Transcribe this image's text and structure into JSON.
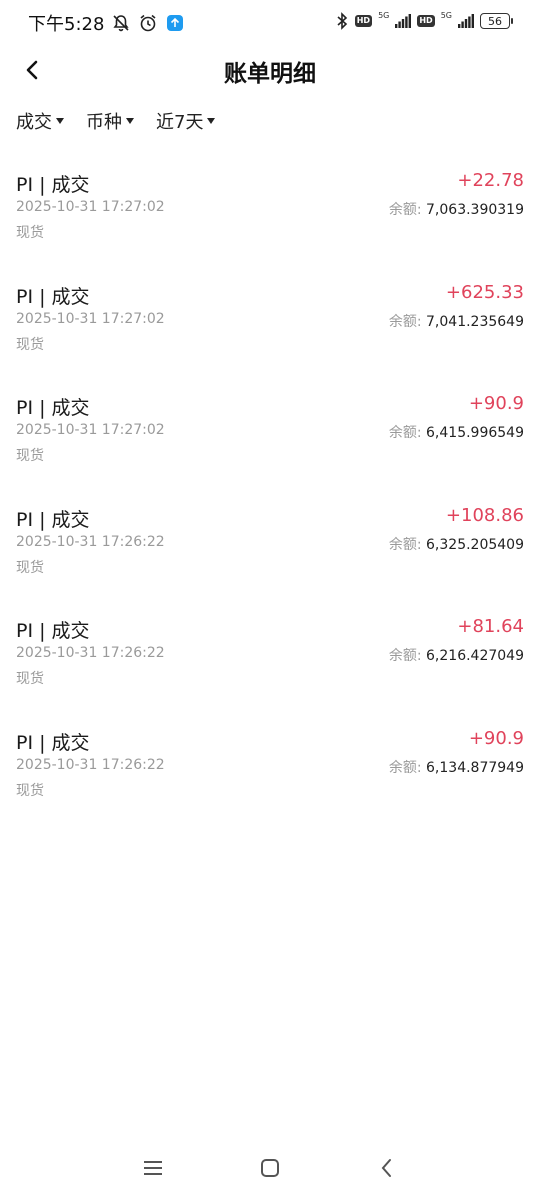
{
  "status": {
    "time": "下午5:28",
    "net1": "5G",
    "net2": "5G",
    "hd1": "HD",
    "hd2": "HD",
    "battery": "56",
    "icons": [
      "bell-off-icon",
      "alarm-icon",
      "upload-app-icon",
      "bluetooth-icon",
      "signal-icon",
      "battery-icon"
    ]
  },
  "header": {
    "title": "账单明细",
    "back_icon": "chevron-left-icon"
  },
  "filters": [
    {
      "label": "成交"
    },
    {
      "label": "币种"
    },
    {
      "label": "近7天"
    }
  ],
  "records": [
    {
      "title": "PI | 成交",
      "time": "2025-10-31 17:27:02",
      "type": "现货",
      "amount": "+22.78",
      "balance_label": "余额:",
      "balance": "7,063.390319"
    },
    {
      "title": "PI | 成交",
      "time": "2025-10-31 17:27:02",
      "type": "现货",
      "amount": "+625.33",
      "balance_label": "余额:",
      "balance": "7,041.235649"
    },
    {
      "title": "PI | 成交",
      "time": "2025-10-31 17:27:02",
      "type": "现货",
      "amount": "+90.9",
      "balance_label": "余额:",
      "balance": "6,415.996549"
    },
    {
      "title": "PI | 成交",
      "time": "2025-10-31 17:26:22",
      "type": "现货",
      "amount": "+108.86",
      "balance_label": "余额:",
      "balance": "6,325.205409"
    },
    {
      "title": "PI | 成交",
      "time": "2025-10-31 17:26:22",
      "type": "现货",
      "amount": "+81.64",
      "balance_label": "余额:",
      "balance": "6,216.427049"
    },
    {
      "title": "PI | 成交",
      "time": "2025-10-31 17:26:22",
      "type": "现货",
      "amount": "+90.9",
      "balance_label": "余额:",
      "balance": "6,134.877949"
    }
  ],
  "colors": {
    "positive": "#e0435b",
    "muted": "#9a9a9a"
  },
  "navbar": [
    "menu-icon",
    "home-square-icon",
    "back-chevron-icon"
  ]
}
